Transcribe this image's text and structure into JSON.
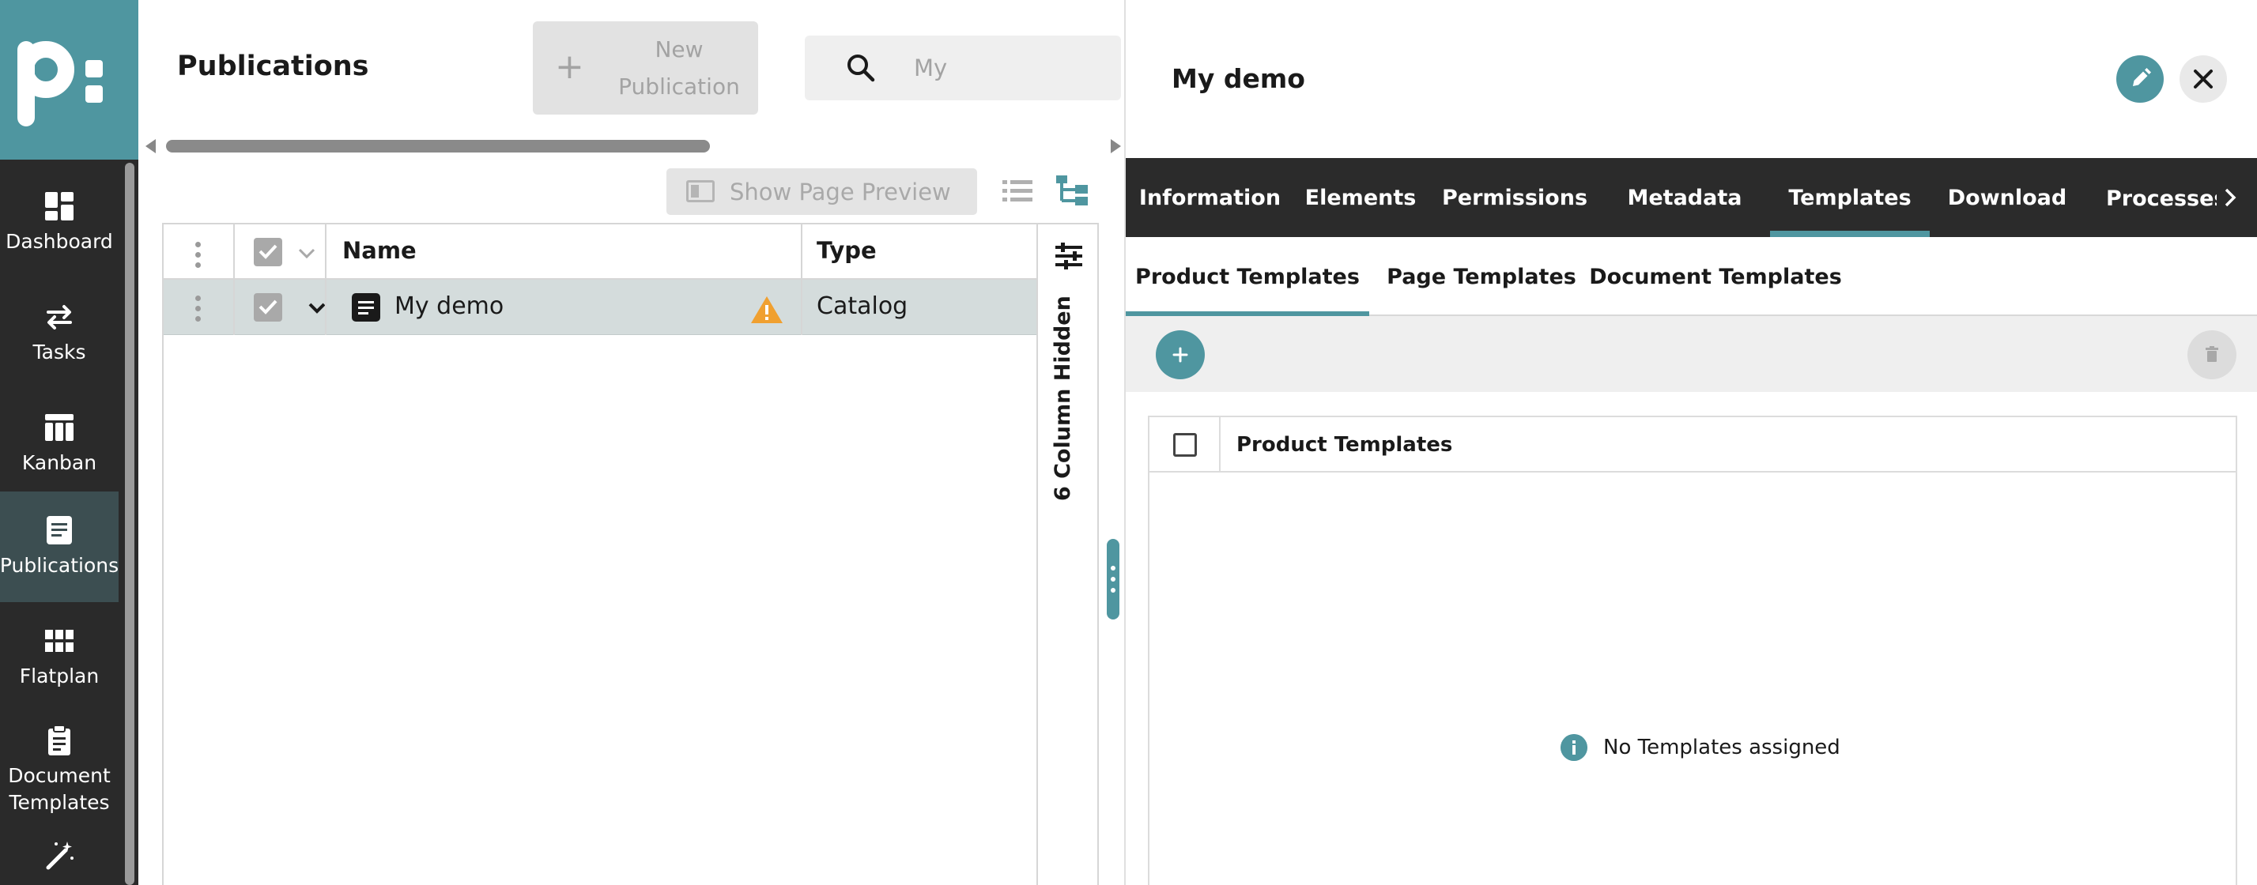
{
  "colors": {
    "accent": "#4f96a0",
    "sidebar": "#2a2a2a",
    "tabbar": "#2b2b2b",
    "warning": "#f0a030",
    "row_selected": "#d4dcdc"
  },
  "sidebar": {
    "logo": "p:",
    "items": [
      {
        "label": "Dashboard",
        "icon": "dashboard-icon",
        "active": false
      },
      {
        "label": "Tasks",
        "icon": "tasks-icon",
        "active": false
      },
      {
        "label": "Kanban",
        "icon": "kanban-icon",
        "active": false
      },
      {
        "label": "Publications",
        "icon": "publications-icon",
        "active": true
      },
      {
        "label": "Flatplan",
        "icon": "flatplan-icon",
        "active": false
      },
      {
        "label": "Document\nTemplates",
        "icon": "clipboard-icon",
        "active": false
      },
      {
        "label": "",
        "icon": "magic-wand-icon",
        "active": false
      }
    ]
  },
  "header": {
    "title": "Publications",
    "new_button": "New\nPublication",
    "search_value": "My",
    "search_icon": "search-icon"
  },
  "toolbar": {
    "preview_label": "Show Page Preview",
    "list_view_icon": "list-view-icon",
    "tree_view_icon": "tree-view-icon"
  },
  "table": {
    "columns": [
      "Name",
      "Type"
    ],
    "hidden_columns_label": "6 Column Hidden",
    "rows": [
      {
        "name": "My demo",
        "type": "Catalog",
        "warning": true,
        "checked": true,
        "expanded": true
      }
    ]
  },
  "panel": {
    "title": "My demo",
    "tabs": [
      "Information",
      "Elements",
      "Permissions",
      "Metadata",
      "Templates",
      "Download",
      "Processes"
    ],
    "active_tab": "Templates",
    "subtabs": [
      "Product Templates",
      "Page Templates",
      "Document Templates"
    ],
    "active_subtab": "Product Templates",
    "table_header": "Product Templates",
    "empty_message": "No Templates assigned"
  }
}
